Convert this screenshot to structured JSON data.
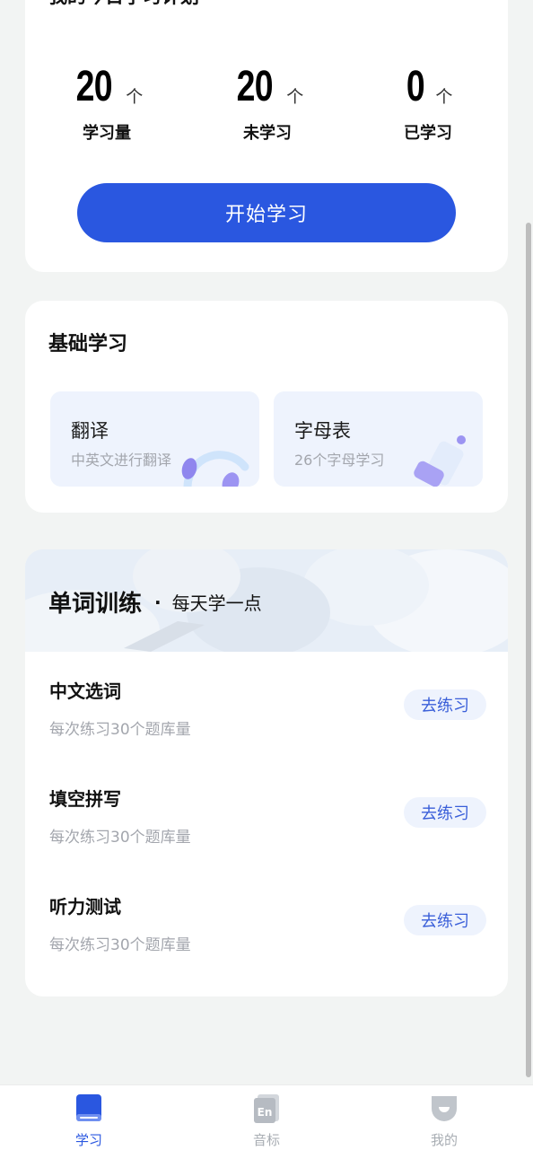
{
  "plan": {
    "title": "我的今日学习计划",
    "stats": [
      {
        "value": "20",
        "unit": "个",
        "label": "学习量"
      },
      {
        "value": "20",
        "unit": "个",
        "label": "未学习"
      },
      {
        "value": "0",
        "unit": "个",
        "label": "已学习"
      }
    ],
    "start_button": "开始学习"
  },
  "basic": {
    "title": "基础学习",
    "tiles": [
      {
        "name": "翻译",
        "desc": "中英文进行翻译"
      },
      {
        "name": "字母表",
        "desc": "26个字母学习"
      }
    ]
  },
  "word_training": {
    "title": "单词训练",
    "dot": "·",
    "subtitle": "每天学一点",
    "items": [
      {
        "name": "中文选词",
        "desc": "每次练习30个题库量",
        "button": "去练习"
      },
      {
        "name": "填空拼写",
        "desc": "每次练习30个题库量",
        "button": "去练习"
      },
      {
        "name": "听力测试",
        "desc": "每次练习30个题库量",
        "button": "去练习"
      }
    ]
  },
  "tabs": [
    {
      "label": "学习",
      "icon": "book-icon",
      "active": true
    },
    {
      "label": "音标",
      "icon": "en-card-icon",
      "active": false
    },
    {
      "label": "我的",
      "icon": "user-shield-icon",
      "active": false
    }
  ],
  "colors": {
    "accent": "#2a57e0",
    "inactive": "#a8adb3",
    "tile_bg": "#eef3fd"
  }
}
